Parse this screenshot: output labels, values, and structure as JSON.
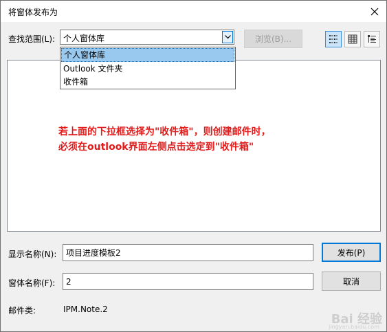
{
  "window": {
    "title": "将窗体发布为"
  },
  "lookin": {
    "label": "查找范围(L):",
    "value": "个人窗体库",
    "browse_label": "浏览(B)..."
  },
  "dropdown": {
    "options": [
      "个人窗体库",
      "Outlook 文件夹",
      "收件箱"
    ],
    "selected_index": 0
  },
  "view_buttons": [
    "list-view-icon",
    "details-view-icon",
    "properties-view-icon"
  ],
  "annotation": {
    "line1": "若上面的下拉框选择为\"收件箱\"，则创建邮件时，",
    "line2": "必须在outlook界面左侧点击选定到\"收件箱\"",
    "color": "#e21a1a"
  },
  "display_name": {
    "label": "显示名称(N):",
    "value": "项目进度模板2",
    "button": "发布(P)"
  },
  "form_name": {
    "label": "窗体名称(F):",
    "value": "2",
    "button": "取消"
  },
  "message_class": {
    "label": "邮件类:",
    "value": "IPM.Note.2"
  },
  "watermark": {
    "text": "Bai 经验",
    "sub": "jingyan.baidu.com"
  }
}
